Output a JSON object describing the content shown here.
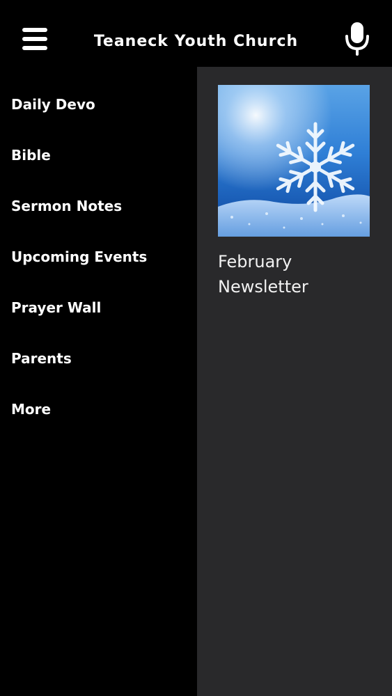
{
  "header": {
    "title": "Teaneck Youth Church",
    "menu_icon": "hamburger-menu-icon",
    "mic_icon": "microphone-icon"
  },
  "drawer": {
    "items": [
      {
        "label": "Daily Devo"
      },
      {
        "label": "Bible"
      },
      {
        "label": "Sermon Notes"
      },
      {
        "label": "Upcoming Events"
      },
      {
        "label": "Prayer Wall"
      },
      {
        "label": "Parents"
      },
      {
        "label": "More"
      }
    ]
  },
  "content": {
    "card": {
      "title": "February Newsletter",
      "image": "snowflake-winter-image"
    }
  },
  "colors": {
    "header_bg": "#000000",
    "drawer_bg": "#000000",
    "content_bg": "#29292b",
    "text": "#ffffff"
  }
}
